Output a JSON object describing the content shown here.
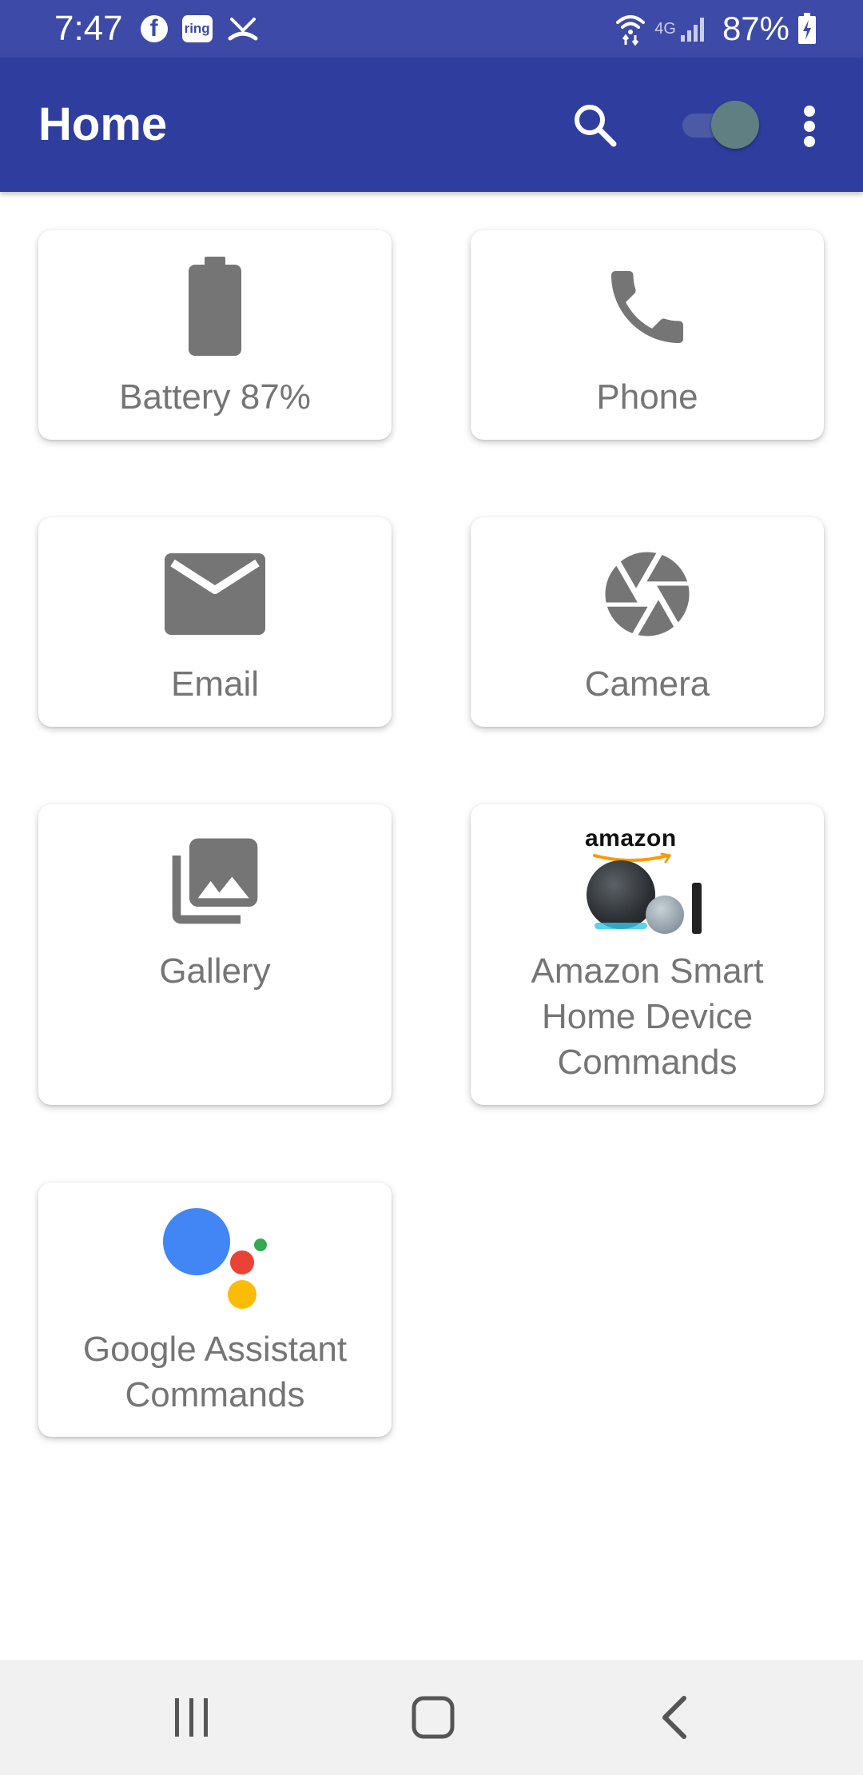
{
  "status_bar": {
    "time": "7:47",
    "facebook_glyph": "f",
    "ring_glyph": "ring",
    "network_label": "4G",
    "battery_text": "87%",
    "icons": [
      "facebook-icon",
      "ring-icon",
      "missed-call-icon",
      "wifi-icon",
      "signal-icon",
      "battery-charging-icon"
    ]
  },
  "app_bar": {
    "title": "Home",
    "color": "#2f3e9e",
    "search_icon": "search-icon",
    "toggle_state": "on",
    "menu_icon": "more-vert-icon"
  },
  "cards": [
    {
      "label": "Battery 87%",
      "icon": "battery-icon"
    },
    {
      "label": "Phone",
      "icon": "phone-icon"
    },
    {
      "label": "Email",
      "icon": "email-icon"
    },
    {
      "label": "Camera",
      "icon": "camera-shutter-icon"
    },
    {
      "label": "Gallery",
      "icon": "gallery-icon"
    },
    {
      "label": "Amazon Smart\nHome Device\nCommands",
      "icon": "amazon-echo-image",
      "logo_text": "amazon"
    },
    {
      "label": "Google Assistant\nCommands",
      "icon": "google-assistant-icon"
    }
  ],
  "nav_bar": {
    "recents_icon": "recents-icon",
    "home_icon": "home-icon",
    "back_icon": "back-icon"
  },
  "colors": {
    "status_bar": "#3d4aa8",
    "icon_gray": "#757575",
    "google_blue": "#4285f4",
    "google_red": "#ea4335",
    "google_yellow": "#fbbc05",
    "google_green": "#34a853"
  }
}
